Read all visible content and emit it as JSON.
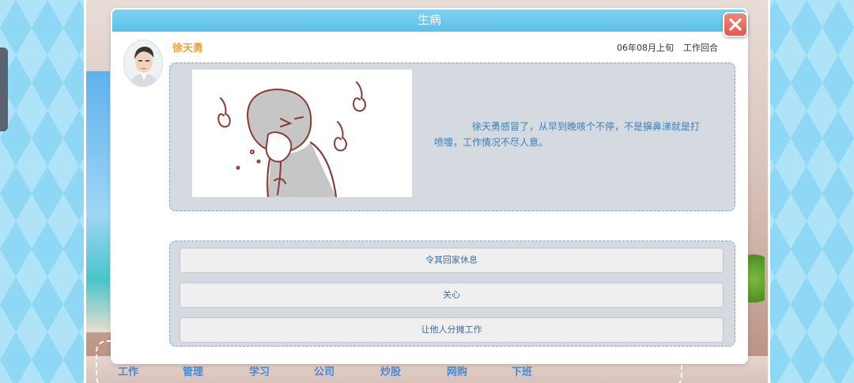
{
  "dialog": {
    "title": "生病",
    "character_name": "徐天勇",
    "date": "06年08月上旬",
    "phase": "工作回合",
    "story": "徐天勇感冒了，从早到晚咳个不停，不是擤鼻涕就是打喷嚏，工作情况不尽人意。",
    "choices": [
      "令其回家休息",
      "关心",
      "让他人分摊工作"
    ]
  },
  "nav": {
    "items": [
      "工作",
      "管理",
      "学习",
      "公司",
      "炒股",
      "网购",
      "下班"
    ]
  },
  "colors": {
    "header": "#5cc1e8",
    "close": "#e25a4e",
    "name": "#f0a23a",
    "story_text": "#3d7fb7",
    "panel": "#d4dae0"
  }
}
